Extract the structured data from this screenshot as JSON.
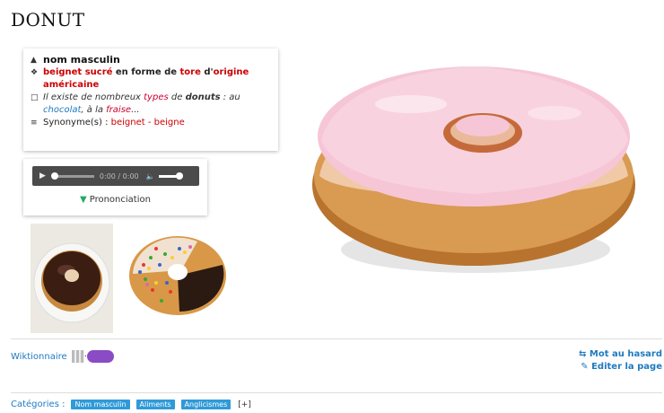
{
  "entry": {
    "word": "DONUT"
  },
  "definition": {
    "pos": "nom masculin",
    "def_part1": "beignet sucré",
    "def_part2": " en forme de ",
    "def_part3": "tore",
    "def_part4": " d'",
    "def_part5": "origine américaine",
    "example_part1": "Il existe de nombreux ",
    "example_part2": "types",
    "example_part3": " de ",
    "example_part4": "donuts",
    "example_part5": " : au ",
    "example_part6": "chocolat",
    "example_part7": ", à la ",
    "example_part8": "fraise",
    "example_part9": "...",
    "synonyms_label": "Synonyme(s) : ",
    "synonyms_value": "beignet - beigne"
  },
  "audio": {
    "time": "0:00 / 0:00",
    "label": "Prononciation"
  },
  "footer": {
    "source": "Wiktionnaire",
    "sep": " · ",
    "random_word": "Mot au hasard",
    "edit_page": "Editer la page"
  },
  "categories": {
    "label": "Catégories :",
    "items": [
      "Nom masculin",
      "Aliments",
      "Anglicismes"
    ],
    "more": "[+]"
  },
  "colors": {
    "link": "#1f7ac0",
    "accent_red": "#c00000",
    "tag_bg": "#2f9ad8"
  }
}
